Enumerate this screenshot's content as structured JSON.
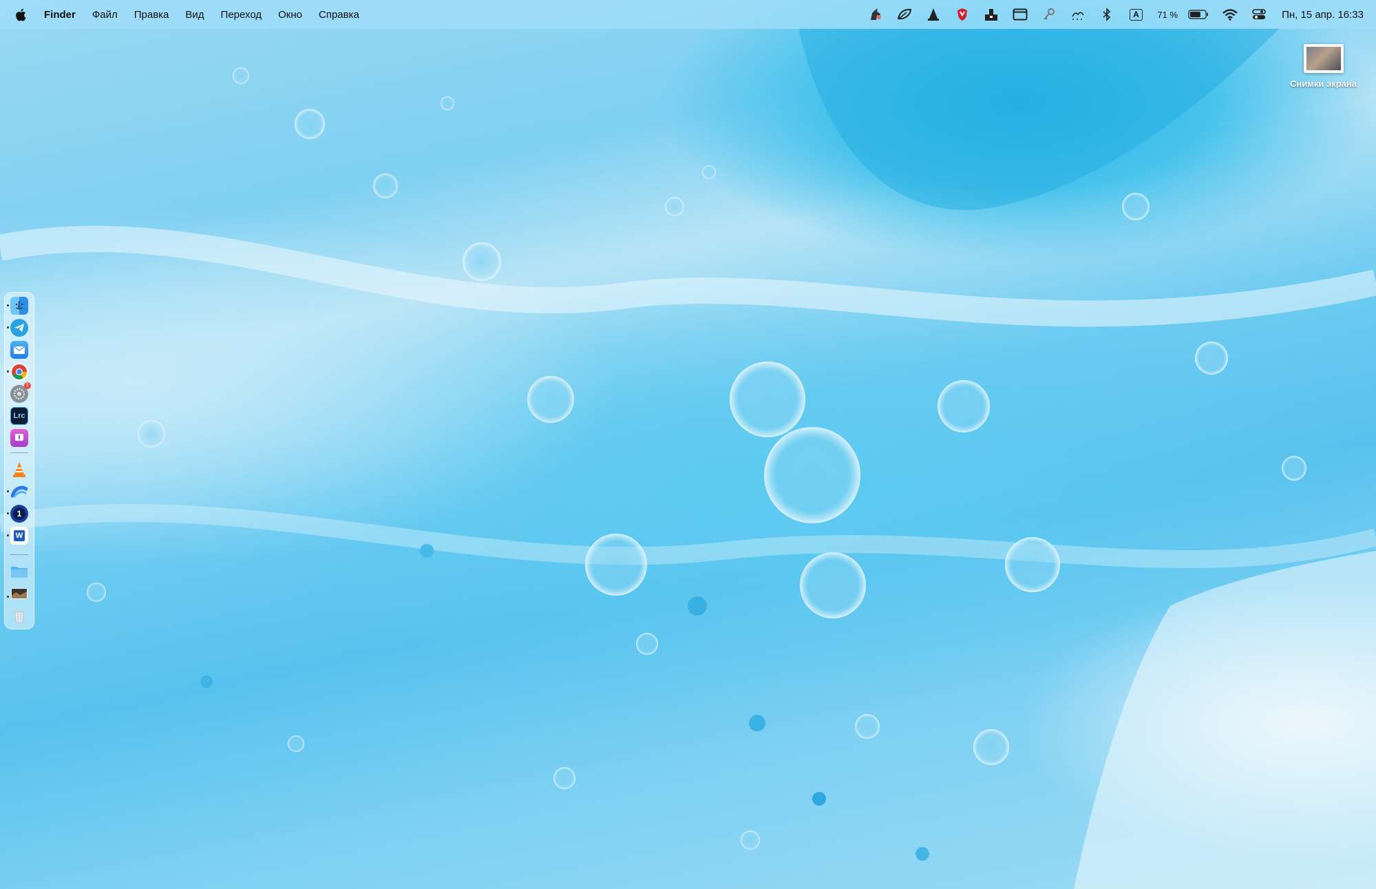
{
  "menubar": {
    "apple_icon": "apple-logo-icon",
    "app_name": "Finder",
    "items": [
      "Файл",
      "Правка",
      "Вид",
      "Переход",
      "Окно",
      "Справка"
    ],
    "status_icons": [
      "unicorn-icon",
      "leaf-icon",
      "ranger-icon",
      "shield-icon",
      "download-tray-icon",
      "window-icon",
      "key-icon",
      "weather-icon",
      "bluetooth-icon"
    ],
    "input_source": "A",
    "battery_percent": "71 %",
    "battery_level": 0.71,
    "clock": "Пн, 15 апр. 16:33"
  },
  "desktop": {
    "folder_label": "Снимки экрана"
  },
  "dock": {
    "apps": [
      "Finder",
      "Telegram",
      "Mail",
      "Google Chrome",
      "System Preferences",
      "Lightroom Classic",
      "Speeko",
      "VLC",
      "Arc",
      "1Password",
      "Microsoft Word"
    ],
    "others": [
      "Downloads",
      "Photos Stack",
      "Trash"
    ],
    "lightroom_text": "Lrc",
    "onepass_text": "1",
    "word_text": "W",
    "settings_badge": "1"
  }
}
